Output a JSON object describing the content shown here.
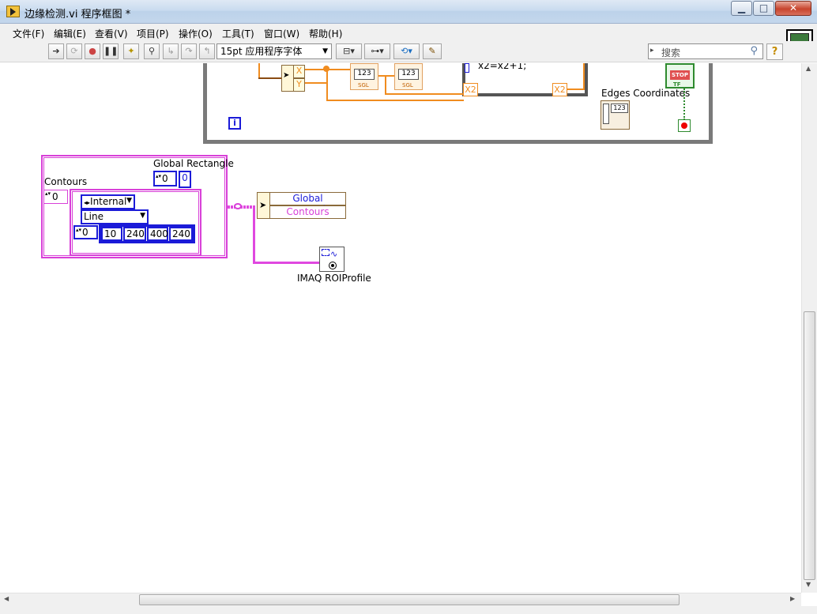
{
  "window": {
    "title": "边缘检测.vi 程序框图 *",
    "minimize_glyph": "▁",
    "maximize_glyph": "□",
    "close_glyph": "✕"
  },
  "menu": [
    "文件(F)",
    "编辑(E)",
    "查看(V)",
    "项目(P)",
    "操作(O)",
    "工具(T)",
    "窗口(W)",
    "帮助(H)"
  ],
  "toolbar": {
    "font_value": "15pt 应用程序字体",
    "search_placeholder": "搜索",
    "help_glyph": "?",
    "vi_icon_number": "3"
  },
  "diagram": {
    "unbundle_x": "X",
    "unbundle_y": "Y",
    "indicator_123_a": "123",
    "indicator_123_b": "123",
    "sgl": "SGL",
    "code_text": "x2=x2+1;",
    "x2_left": "X2",
    "x2_right": "X2",
    "edges_coordinates": "Edges Coordinates",
    "stop": "STOP",
    "tf": "TF",
    "loop_i": "i",
    "global_rectangle_label": "Global Rectangle",
    "global_rectangle_index": "0",
    "global_rectangle_value": "0",
    "contours_label": "Contours",
    "contours_index": "0",
    "contour_type": "Internal",
    "contour_shape": "Line",
    "coords_index": "0",
    "coords": [
      "10",
      "240",
      "400",
      "240"
    ],
    "bundle_field_1": "Global Rectangle",
    "bundle_field_2": "Contours",
    "roi_profile_label": "IMAQ ROIProfile"
  },
  "colors": {
    "orange_wire": "#f08c1f",
    "pink_wire": "#e048e0",
    "cluster_blue": "#1b1bd8",
    "loop_gray": "#7a7a7a",
    "stop_green": "#2e8a2e"
  }
}
